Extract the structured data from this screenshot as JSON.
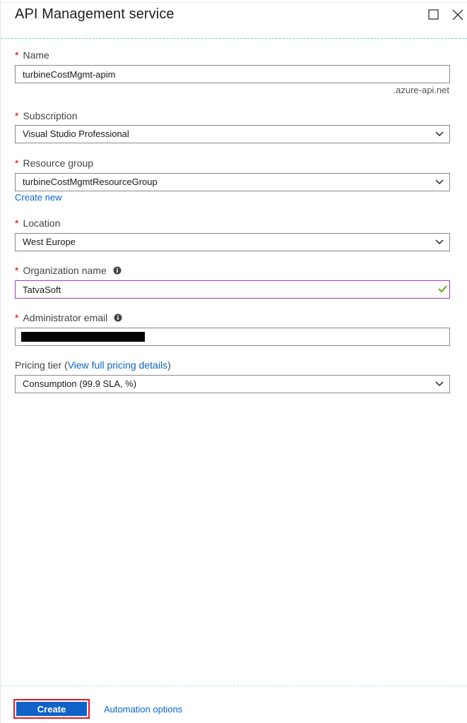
{
  "header": {
    "title": "API Management service",
    "maximize_icon": "square-maximize-icon",
    "close_icon": "close-x-icon"
  },
  "form": {
    "required_marker": "*",
    "name": {
      "label": "Name",
      "value": "turbineCostMgmt-apim",
      "suffix": ".azure-api.net"
    },
    "subscription": {
      "label": "Subscription",
      "value": "Visual Studio Professional"
    },
    "resource_group": {
      "label": "Resource group",
      "value": "turbineCostMgmtResourceGroup",
      "create_new": "Create new"
    },
    "location": {
      "label": "Location",
      "value": "West Europe"
    },
    "organization_name": {
      "label": "Organization name",
      "value": "TatvaSoft"
    },
    "admin_email": {
      "label": "Administrator email"
    },
    "pricing_tier": {
      "label_prefix": "Pricing tier (",
      "link": "View full pricing details",
      "label_suffix": ")",
      "value": "Consumption (99.9 SLA, %)"
    }
  },
  "footer": {
    "create_label": "Create",
    "automation_label": "Automation options"
  },
  "colors": {
    "accent_blue": "#0f62c8",
    "link_blue": "#0a64c8",
    "required_red": "#d40000",
    "valid_green": "#57a300",
    "focus_purple": "#9b3fc4",
    "highlight_red": "#e01b24",
    "header_dash": "#6ec6e0"
  }
}
